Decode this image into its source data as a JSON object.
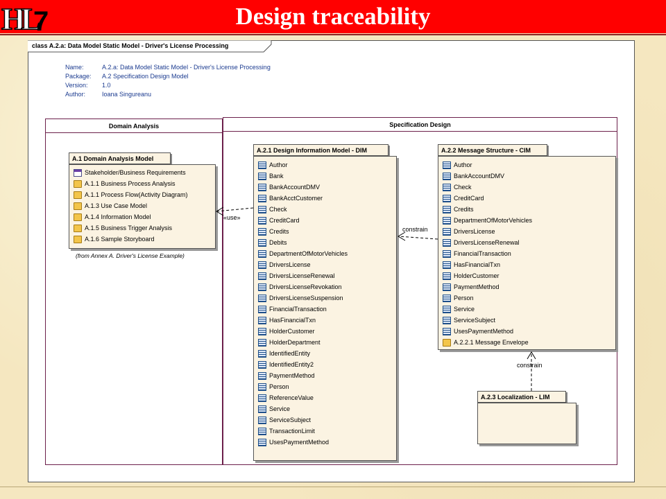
{
  "slide": {
    "title": "Design traceability",
    "logo_text": "HL7"
  },
  "frame": {
    "label": "class A.2.a: Data Model Static Model - Driver's License Processing"
  },
  "meta": {
    "name_key": "Name:",
    "name_val": "A.2.a: Data Model Static Model - Driver's License Processing",
    "package_key": "Package:",
    "package_val": "A.2 Specification Design Model",
    "version_key": "Version:",
    "version_val": "1.0",
    "author_key": "Author:",
    "author_val": "Ioana Singureanu"
  },
  "lanes": {
    "domain": "Domain Analysis",
    "spec": "Specification Design"
  },
  "pkg_a1": {
    "title": "A.1 Domain Analysis Model",
    "items": [
      {
        "icon": "requirements-icon",
        "label": "Stakeholder/Business Requirements"
      },
      {
        "icon": "folder-icon",
        "label": "A.1.1 Business Process Analysis"
      },
      {
        "icon": "folder-icon",
        "label": "A.1.1 Process Flow(Activity Diagram)"
      },
      {
        "icon": "folder-icon",
        "label": "A.1.3 Use Case Model"
      },
      {
        "icon": "folder-icon",
        "label": "A.1.4 Information Model"
      },
      {
        "icon": "folder-icon",
        "label": "A.1.5 Business Trigger Analysis"
      },
      {
        "icon": "folder-icon",
        "label": "A.1.6 Sample Storyboard"
      }
    ],
    "note": "(from Annex A. Driver's License Example)"
  },
  "pkg_a21": {
    "title": "A.2.1 Design Information Model - DIM",
    "items": [
      "Author",
      "Bank",
      "BankAccountDMV",
      "BankAcctCustomer",
      "Check",
      "CreditCard",
      "Credits",
      "Debits",
      "DepartmentOfMotorVehicles",
      "DriversLicense",
      "DriversLicenseRenewal",
      "DriversLicenseRevokation",
      "DriversLicenseSuspension",
      "FinancialTransaction",
      "HasFinancialTxn",
      "HolderCustomer",
      "HolderDepartment",
      "IdentifiedEntity",
      "IdentifiedEntity2",
      "PaymentMethod",
      "Person",
      "ReferenceValue",
      "Service",
      "ServiceSubject",
      "TransactionLimit",
      "UsesPaymentMethod"
    ]
  },
  "pkg_a22": {
    "title": "A.2.2 Message Structure - CIM",
    "items": [
      "Author",
      "BankAccountDMV",
      "Check",
      "CreditCard",
      "Credits",
      "DepartmentOfMotorVehicles",
      "DriversLicense",
      "DriversLicenseRenewal",
      "FinancialTransaction",
      "HasFinancialTxn",
      "HolderCustomer",
      "PaymentMethod",
      "Person",
      "Service",
      "ServiceSubject",
      "UsesPaymentMethod"
    ],
    "folder_item": "A.2.2.1 Message Envelope"
  },
  "pkg_a23": {
    "title": "A.2.3 Localization - LIM"
  },
  "connectors": {
    "use": "«use»",
    "constrain1": "constrain",
    "constrain2": "constrain"
  },
  "colors": {
    "title_bar": "#ff0000",
    "meta_text": "#1a3a8f",
    "lane_border": "#6b1f4a",
    "package_fill": "#fbf3e2"
  }
}
